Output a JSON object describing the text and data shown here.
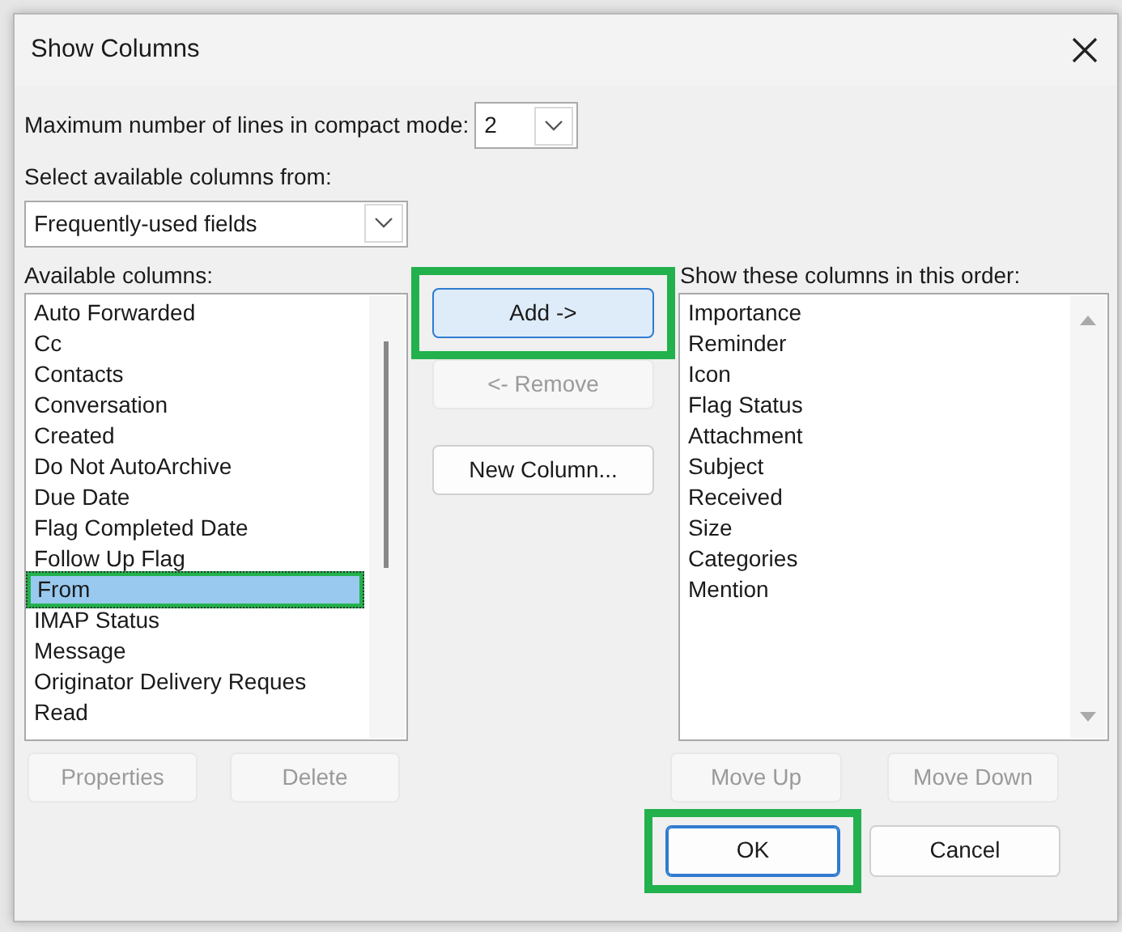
{
  "window": {
    "title": "Show Columns"
  },
  "compact_lines": {
    "label": "Maximum number of lines in compact mode:",
    "value": "2"
  },
  "source": {
    "label": "Select available columns from:",
    "value": "Frequently-used fields"
  },
  "available": {
    "label": "Available columns:",
    "items": [
      {
        "label": "Auto Forwarded",
        "selected": false,
        "highlighted": false
      },
      {
        "label": "Cc",
        "selected": false,
        "highlighted": false
      },
      {
        "label": "Contacts",
        "selected": false,
        "highlighted": false
      },
      {
        "label": "Conversation",
        "selected": false,
        "highlighted": false
      },
      {
        "label": "Created",
        "selected": false,
        "highlighted": false
      },
      {
        "label": "Do Not AutoArchive",
        "selected": false,
        "highlighted": false
      },
      {
        "label": "Due Date",
        "selected": false,
        "highlighted": false
      },
      {
        "label": "Flag Completed Date",
        "selected": false,
        "highlighted": false
      },
      {
        "label": "Follow Up Flag",
        "selected": false,
        "highlighted": false
      },
      {
        "label": "From",
        "selected": true,
        "highlighted": true
      },
      {
        "label": "IMAP Status",
        "selected": false,
        "highlighted": false
      },
      {
        "label": "Message",
        "selected": false,
        "highlighted": false
      },
      {
        "label": "Originator Delivery Reques",
        "selected": false,
        "highlighted": false
      },
      {
        "label": "Read",
        "selected": false,
        "highlighted": false
      }
    ]
  },
  "middle_buttons": [
    {
      "label": "Add ->",
      "disabled": false,
      "highlighted": true
    },
    {
      "label": "<- Remove",
      "disabled": true,
      "highlighted": false
    },
    {
      "label": "New Column...",
      "disabled": false,
      "highlighted": false
    }
  ],
  "shown": {
    "label": "Show these columns in this order:",
    "items": [
      {
        "label": "Importance",
        "selected": false
      },
      {
        "label": "Reminder",
        "selected": false
      },
      {
        "label": "Icon",
        "selected": false
      },
      {
        "label": "Flag Status",
        "selected": false
      },
      {
        "label": "Attachment",
        "selected": false
      },
      {
        "label": "Subject",
        "selected": false
      },
      {
        "label": "Received",
        "selected": false
      },
      {
        "label": "Size",
        "selected": false
      },
      {
        "label": "Categories",
        "selected": false
      },
      {
        "label": "Mention",
        "selected": false
      }
    ]
  },
  "available_buttons": [
    {
      "label": "Properties",
      "disabled": true
    },
    {
      "label": "Delete",
      "disabled": true
    }
  ],
  "shown_buttons": [
    {
      "label": "Move Up",
      "disabled": true
    },
    {
      "label": "Move Down",
      "disabled": true
    }
  ],
  "dialog_buttons": [
    {
      "label": "OK",
      "default": true,
      "highlighted": true
    },
    {
      "label": "Cancel",
      "default": false,
      "highlighted": false
    }
  ]
}
